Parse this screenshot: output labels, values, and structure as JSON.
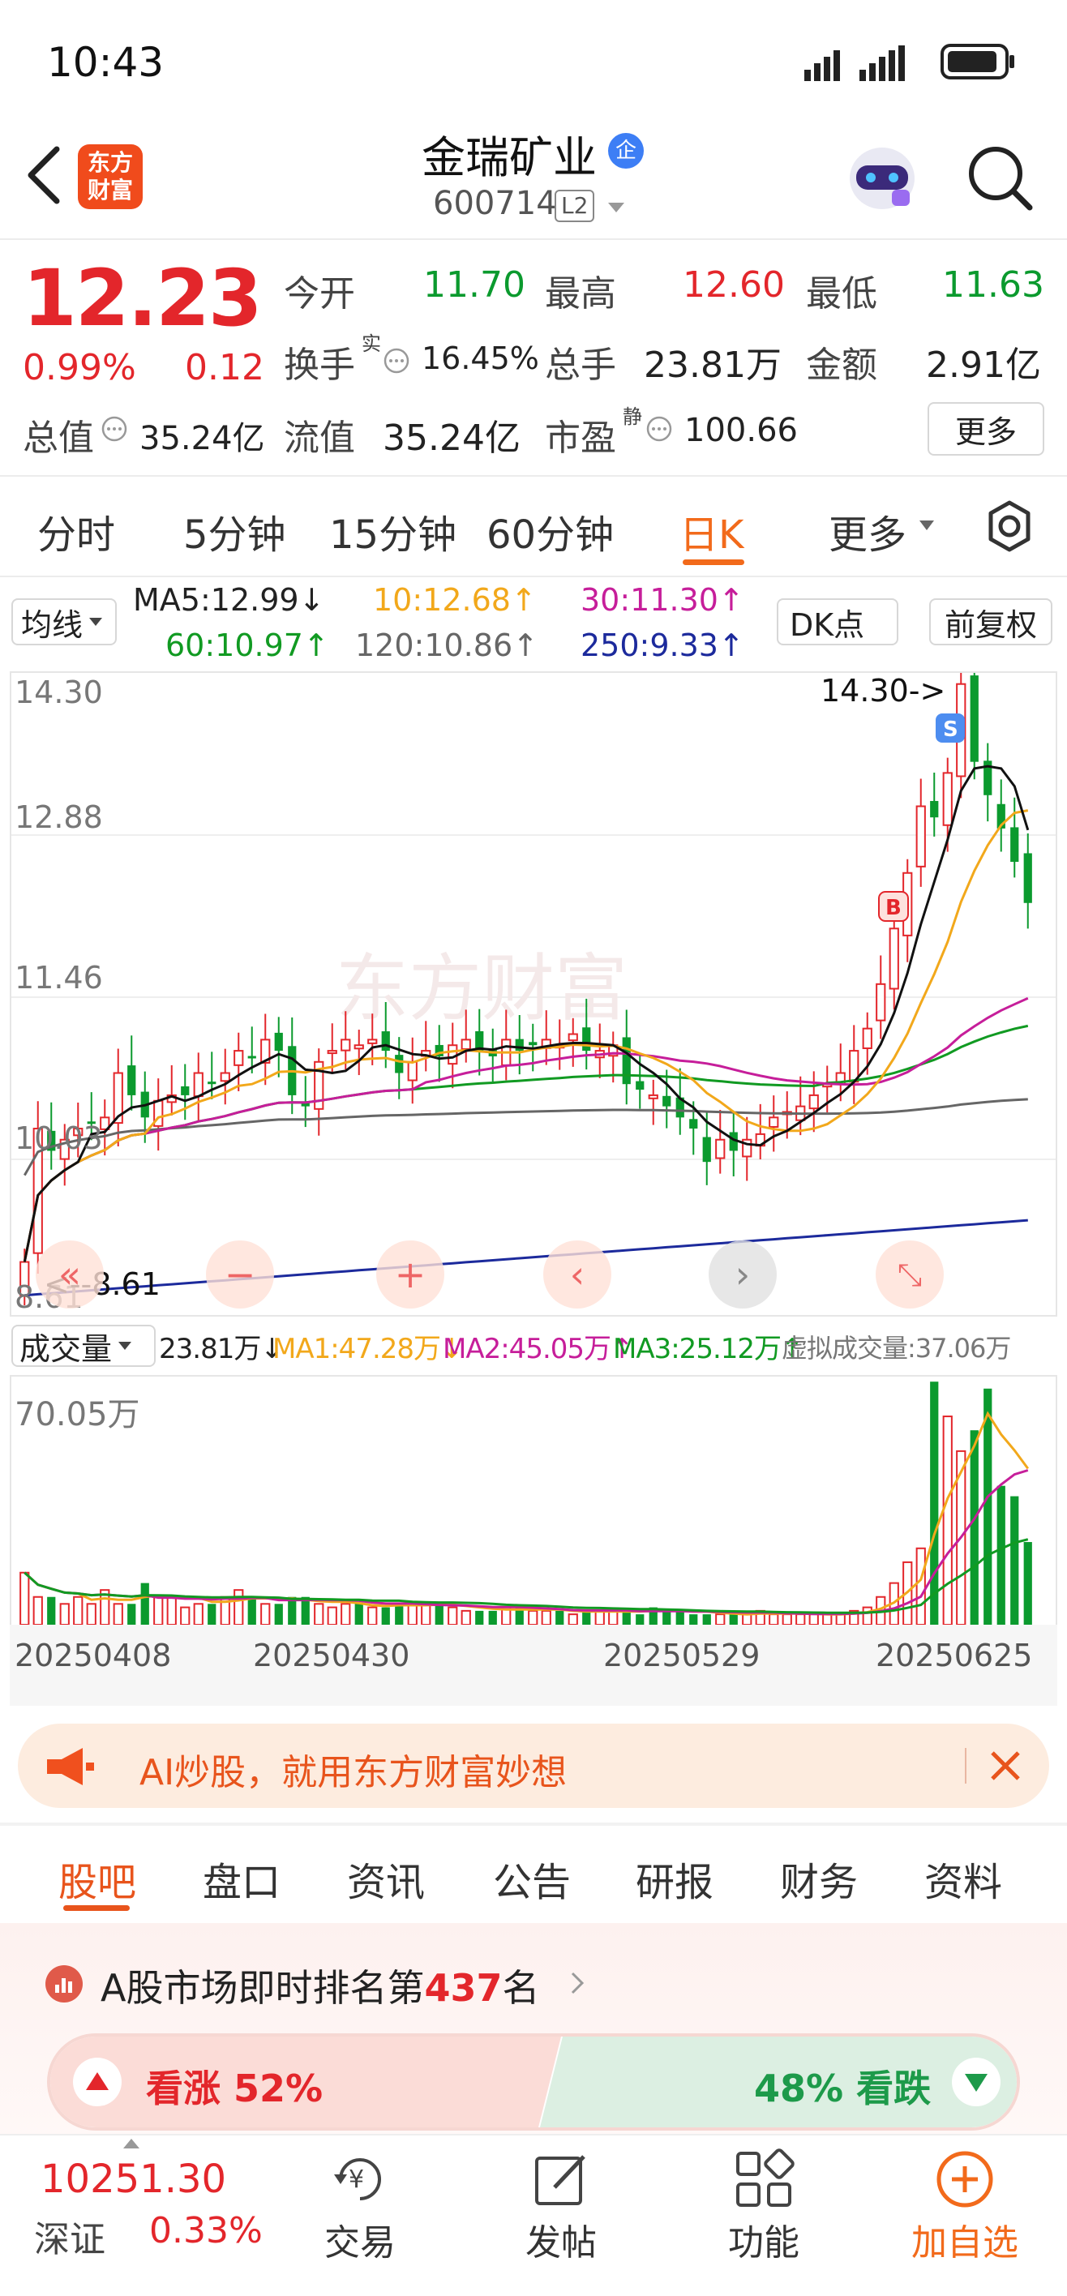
{
  "status": {
    "time": "10:43"
  },
  "header": {
    "brand": "东方财富",
    "name": "金瑞矿业",
    "badge": "企",
    "code": "600714",
    "level": "L2"
  },
  "quote": {
    "price": "12.23",
    "pct": "0.99%",
    "chg": "0.12",
    "open_l": "今开",
    "open": "11.70",
    "high_l": "最高",
    "high": "12.60",
    "low_l": "最低",
    "low": "11.63",
    "turn_l": "换手",
    "turn_sup": "实",
    "turn": "16.45%",
    "vol_l": "总手",
    "vol": "23.81万",
    "amt_l": "金额",
    "amt": "2.91亿",
    "mcap_l": "总值",
    "mcap": "35.24亿",
    "fcap_l": "流值",
    "fcap": "35.24亿",
    "pe_l": "市盈",
    "pe_sup": "静",
    "pe": "100.66",
    "more": "更多"
  },
  "ktabs": {
    "t1": "分时",
    "t2": "5分钟",
    "t3": "15分钟",
    "t4": "60分钟",
    "t5": "日K",
    "t6": "更多"
  },
  "ma": {
    "sel": "均线",
    "ma5": "MA5:12.99↓",
    "ma10": "10:12.68↑",
    "ma30": "30:11.30↑",
    "ma60": "60:10.97↑",
    "ma120": "120:10.86↑",
    "ma250": "250:9.33↑",
    "dk": "DK点",
    "fq": "前复权"
  },
  "kchart": {
    "y1": "14.30",
    "y2": "12.88",
    "y3": "11.46",
    "y4": "10.03",
    "y5": "8.61",
    "hi": "14.30->",
    "lo": "<--8.61",
    "wm": "东方财富"
  },
  "volume": {
    "sel": "成交量",
    "v": "23.81万↓",
    "ma1": "MA1:47.28万↓",
    "ma2": "MA2:45.05万↑",
    "ma3": "MA3:25.12万↑",
    "virt": "虚拟成交量:37.06万",
    "ymax": "70.05万"
  },
  "dates": {
    "d1": "20250408",
    "d2": "20250430",
    "d3": "20250529",
    "d4": "20250625"
  },
  "banner": {
    "text": "AI炒股，就用东方财富妙想"
  },
  "tabs": {
    "t1": "股吧",
    "t2": "盘口",
    "t3": "资讯",
    "t4": "公告",
    "t5": "研报",
    "t6": "财务",
    "t7": "资料"
  },
  "rank": {
    "pre": "A股市场即时排名第",
    "num": "437",
    "post": "名"
  },
  "vote": {
    "up": "看涨 52%",
    "down": "48% 看跌"
  },
  "bottom": {
    "idx": "10251.30",
    "idxname": "深证",
    "idxpct": "0.33%",
    "b1": "交易",
    "b2": "发帖",
    "b3": "功能",
    "b4": "加自选"
  },
  "colors": {
    "up": "#e3262b",
    "down": "#0b9a2e",
    "accent": "#f26a1b"
  },
  "chart_data": {
    "type": "candlestick",
    "ylim": [
      8.61,
      14.3
    ],
    "high": 14.3,
    "low": 8.61,
    "closes": [
      9.0,
      10.2,
      10.0,
      10.1,
      10.2,
      10.25,
      10.3,
      10.7,
      10.5,
      10.3,
      10.45,
      10.5,
      10.5,
      10.7,
      10.6,
      10.7,
      10.9,
      10.85,
      11.0,
      10.9,
      10.5,
      10.4,
      10.8,
      10.9,
      11.0,
      10.95,
      11.0,
      10.9,
      10.7,
      10.8,
      10.9,
      10.85,
      10.95,
      11.0,
      10.9,
      10.85,
      11.0,
      10.9,
      10.95,
      11.0,
      10.95,
      11.05,
      10.9,
      10.9,
      10.95,
      10.6,
      10.55,
      10.5,
      10.4,
      10.3,
      10.2,
      9.9,
      10.1,
      10.0,
      10.1,
      10.15,
      10.3,
      10.35,
      10.4,
      10.5,
      10.6,
      10.7,
      10.9,
      11.1,
      11.5,
      12.0,
      12.5,
      13.1,
      13.0,
      13.4,
      14.2,
      13.5,
      13.2,
      12.9,
      12.6,
      12.23
    ],
    "volume_ylim": [
      0,
      70.05
    ],
    "volumes": [
      15,
      8,
      8,
      6,
      8,
      6,
      10,
      6,
      6,
      12,
      8,
      8,
      5,
      6,
      6,
      8,
      10,
      8,
      6,
      6,
      8,
      8,
      6,
      5,
      6,
      6,
      5,
      5,
      6,
      6,
      6,
      6,
      5,
      4,
      4,
      4,
      5,
      5,
      4,
      4,
      4,
      3,
      4,
      4,
      4,
      4,
      3,
      5,
      4,
      4,
      3,
      3,
      3,
      3,
      3,
      4,
      3,
      3,
      3,
      3,
      3,
      3,
      4,
      5,
      8,
      12,
      18,
      22,
      70,
      60,
      50,
      56,
      68,
      40,
      37,
      23.81
    ]
  }
}
